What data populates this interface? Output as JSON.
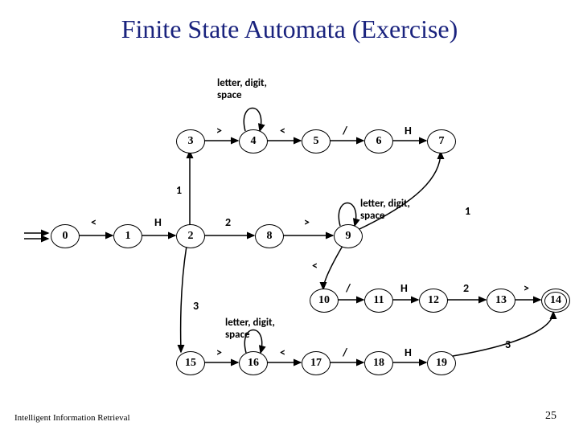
{
  "title": "Finite State Automata (Exercise)",
  "footer": "Intelligent Information Retrieval",
  "page": "25",
  "nodes": {
    "n0": "0",
    "n1": "1",
    "n2": "2",
    "n3": "3",
    "n4": "4",
    "n5": "5",
    "n6": "6",
    "n7": "7",
    "n8": "8",
    "n9": "9",
    "n10": "10",
    "n11": "11",
    "n12": "12",
    "n13": "13",
    "n14": "14",
    "n15": "15",
    "n16": "16",
    "n17": "17",
    "n18": "18",
    "n19": "19"
  },
  "labels": {
    "top_loop": "letter, digit,\nspace",
    "mid_lds": "letter, digit,\nspace",
    "bot_lds": "letter, digit,\nspace"
  },
  "edges": {
    "e_lt_01": "<",
    "e_h_12": "H",
    "e_1_23": "1",
    "e_gt_34": ">",
    "e_lt_45": "<",
    "e_sl_56": "/",
    "e_h_67": "H",
    "e_2_28": "2",
    "e_gt_89": ">",
    "e_1_97": "1",
    "e_lt_910": "<",
    "e_sl_1011": "/",
    "e_h_1112": "H",
    "e_2_1213": "2",
    "e_gt_1314": ">",
    "e_3_215": "3",
    "e_gt_1516": ">",
    "e_lt_1617": "<",
    "e_sl_1718": "/",
    "e_h_1819": "H",
    "e_3_1914": "3"
  }
}
